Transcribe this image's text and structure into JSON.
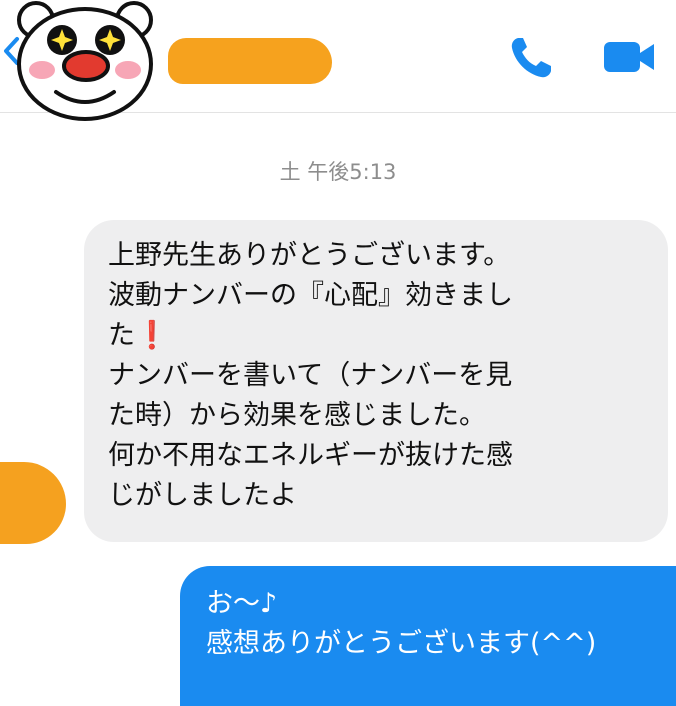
{
  "header": {
    "back_icon": "chevron-left-icon",
    "call_icon": "phone-icon",
    "video_icon": "video-camera-icon",
    "accent_color": "#1a8bf0",
    "redaction_color": "#f6a21e"
  },
  "conversation": {
    "timestamp": "土 午後5:13",
    "incoming_message": {
      "lines": [
        "上野先生ありがとうございます。",
        "波動ナンバーの『心配』効きまし",
        "た❗",
        "ナンバーを書いて（ナンバーを見",
        "た時）から効果を感じました。",
        "何か不用なエネルギーが抜けた感",
        "じがしましたよ"
      ]
    },
    "outgoing_message": {
      "lines": [
        "お〜♪",
        "感想ありがとうございます(^^)"
      ]
    }
  }
}
